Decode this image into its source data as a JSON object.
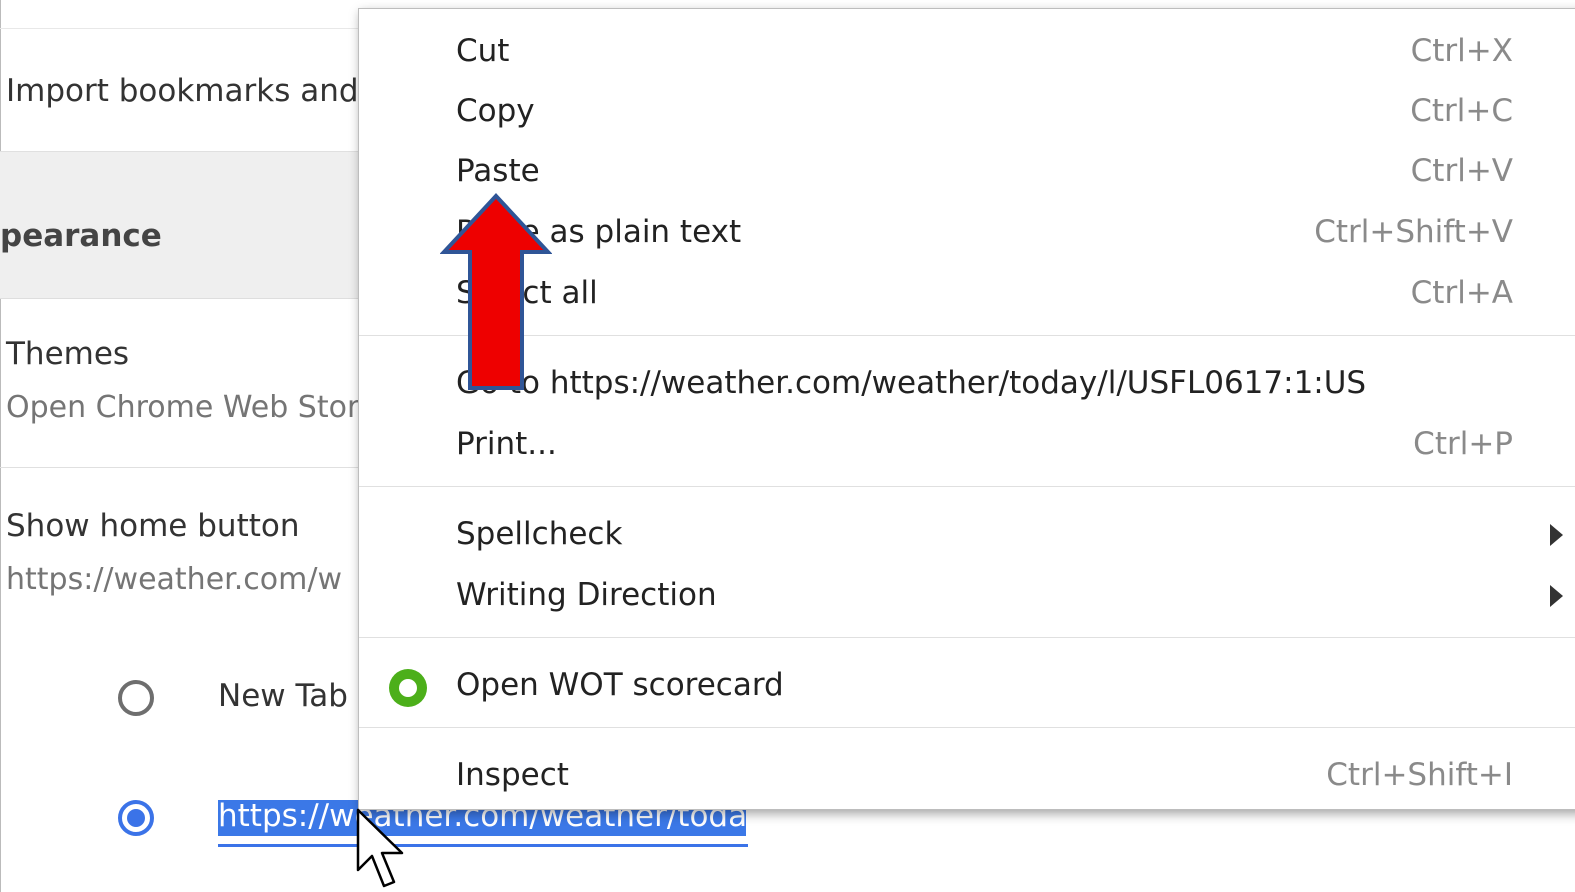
{
  "settings": {
    "import_label": "Import bookmarks and",
    "appearance_label": "pearance",
    "themes": {
      "title": "Themes",
      "subtitle": "Open Chrome Web Stor"
    },
    "home": {
      "title": "Show home button",
      "subtitle": "https://weather.com/w"
    },
    "startup_options": {
      "new_tab_label": "New Tab",
      "custom_url_value": "https://weather.com/weather/toda"
    }
  },
  "context_menu": {
    "items": [
      {
        "label": "Cut",
        "shortcut": "Ctrl+X"
      },
      {
        "label": "Copy",
        "shortcut": "Ctrl+C"
      },
      {
        "label": "Paste",
        "shortcut": "Ctrl+V"
      },
      {
        "label": "Paste as plain text",
        "shortcut": "Ctrl+Shift+V"
      },
      {
        "label": "Select all",
        "shortcut": "Ctrl+A"
      },
      {
        "label": "Go to https://weather.com/weather/today/l/USFL0617:1:US",
        "shortcut": ""
      },
      {
        "label": "Print...",
        "shortcut": "Ctrl+P"
      },
      {
        "label": "Spellcheck",
        "submenu": true
      },
      {
        "label": "Writing Direction",
        "submenu": true
      },
      {
        "label": "Open WOT scorecard",
        "icon": "wot-icon"
      },
      {
        "label": "Inspect",
        "shortcut": "Ctrl+Shift+I"
      }
    ]
  },
  "colors": {
    "accent": "#3b73e8",
    "annotation_arrow_fill": "#ee0000",
    "annotation_arrow_stroke": "#2f5597",
    "wot_icon": "#4caf1a"
  },
  "icons": [
    "radio-unchecked-icon",
    "radio-checked-icon",
    "wot-icon",
    "submenu-arrow-icon",
    "annotation-up-arrow-icon",
    "mouse-cursor-icon"
  ]
}
